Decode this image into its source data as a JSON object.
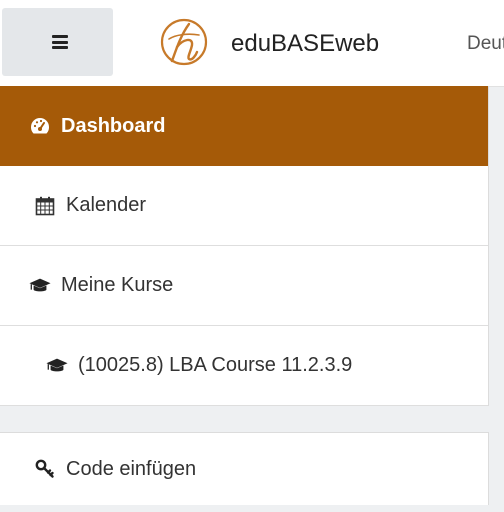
{
  "header": {
    "brand_name": "eduBASEweb",
    "language": "Deutsch",
    "menu_icon": "hamburger-icon",
    "logo": "edubase-logo"
  },
  "sidebar": {
    "items": [
      {
        "label": "Dashboard",
        "icon": "dashboard-icon",
        "active": true
      },
      {
        "label": "Kalender",
        "icon": "calendar-icon"
      },
      {
        "label": "Meine Kurse",
        "icon": "graduation-cap-icon"
      },
      {
        "label": "(10025.8) LBA Course 11.2.3.9",
        "icon": "graduation-cap-icon"
      }
    ],
    "secondary_items": [
      {
        "label": "Code einfügen",
        "icon": "key-icon"
      }
    ]
  },
  "colors": {
    "accent": "#a55a08",
    "logo": "#c77a2a"
  }
}
